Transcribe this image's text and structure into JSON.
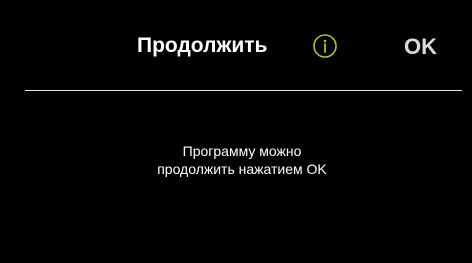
{
  "header": {
    "title": "Продолжить",
    "info_icon": "info-circle-icon",
    "ok_label": "OK"
  },
  "message": {
    "line1": "Программу можно",
    "line2": "продолжить нажатием OK"
  },
  "colors": {
    "background": "#000000",
    "text": "#ffffff",
    "accent": "#a6c43a",
    "ok": "#d9d9d9",
    "divider": "#e6e6e6"
  }
}
